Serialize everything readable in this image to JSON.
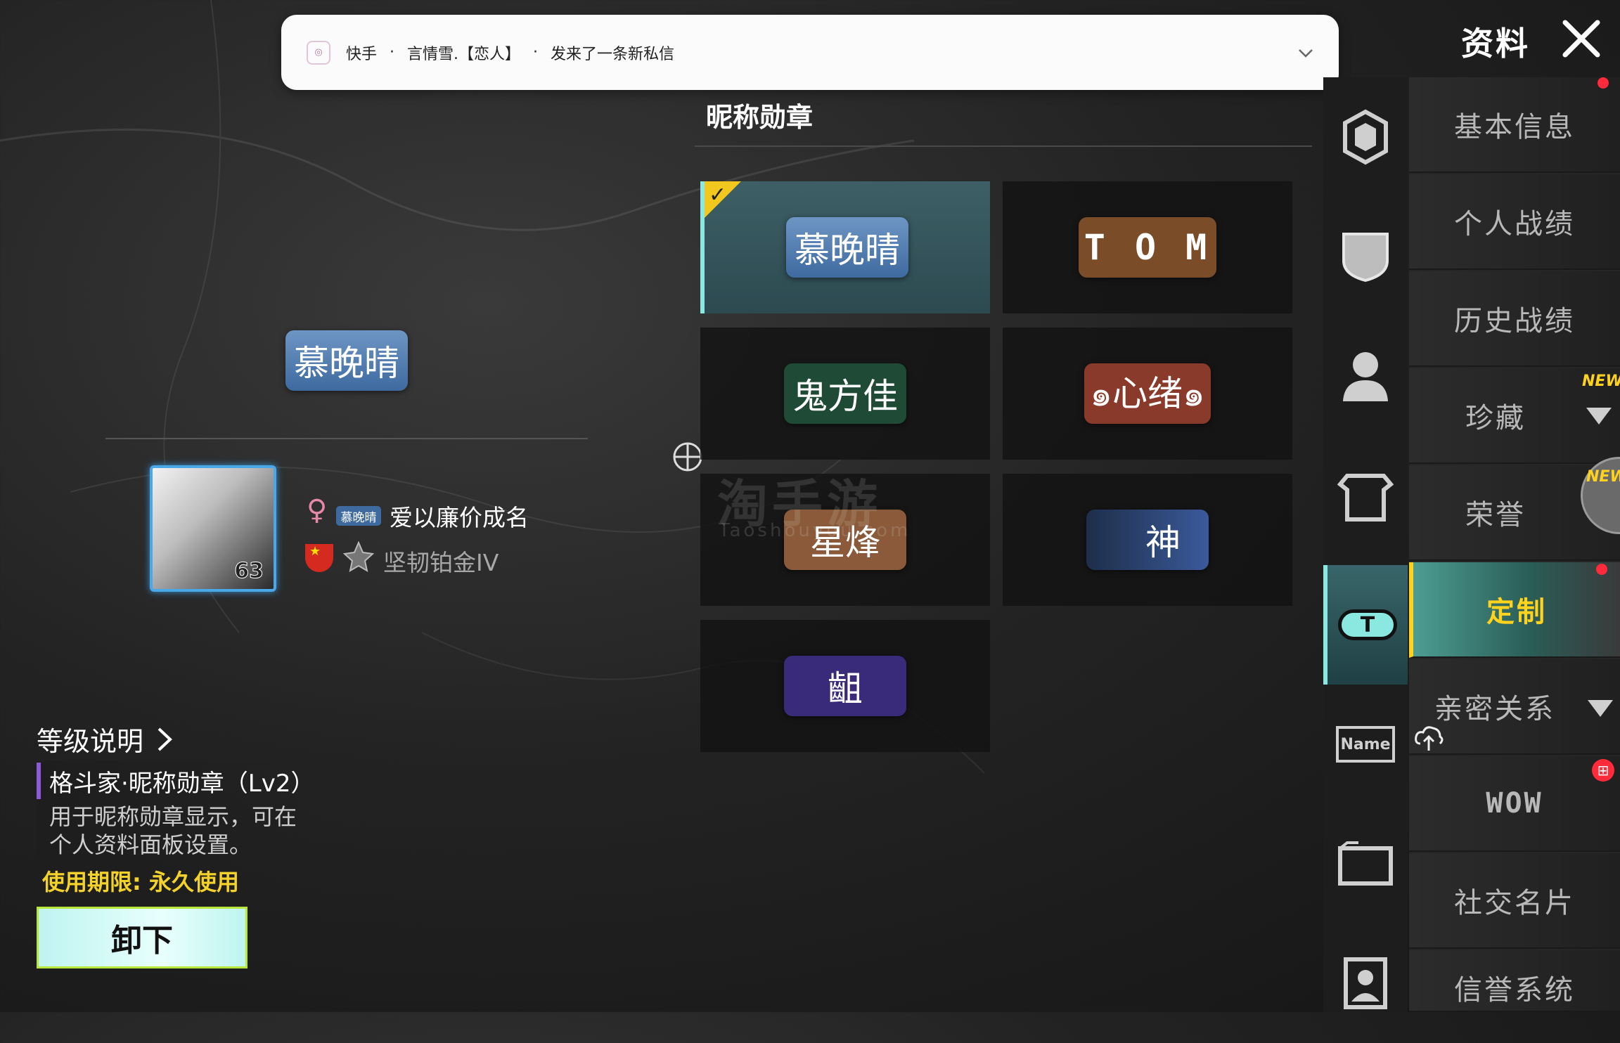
{
  "notification": {
    "app_name": "快手",
    "sender": "言情雪.【恋人】",
    "message": "发来了一条新私信",
    "separator": "·"
  },
  "header": {
    "title": "资料"
  },
  "left": {
    "preview_badge": "慕晚晴",
    "avatar_level": "63",
    "mini_badge": "慕晚晴",
    "player_name": "爱以廉价成名",
    "rank": "坚韧铂金IV",
    "level_link": "等级说明",
    "item_title": "格斗家·昵称勋章（Lv2）",
    "item_desc": "用于昵称勋章显示，可在个人资料面板设置。",
    "item_expire": "使用期限: 永久使用",
    "unequip_label": "卸下"
  },
  "center": {
    "title": "昵称勋章",
    "badges": [
      {
        "label": "慕晚晴",
        "color": "#4f7fb6",
        "selected": true
      },
      {
        "label": "T O M",
        "color": "#7a4c28"
      },
      {
        "label": "鬼方佳",
        "color": "#1f4a36"
      },
      {
        "label": "๑心绪๑",
        "color": "#8a3a2a"
      },
      {
        "label": "星烽",
        "color": "#8a5a3a"
      },
      {
        "label": "神",
        "color": "#2c4a7a"
      },
      {
        "label": "齟",
        "color": "#3a2a7a"
      }
    ],
    "watermark": "淘手游",
    "watermark_sub": "Taoshouyou.com"
  },
  "menu": {
    "items": [
      {
        "label": "基本信息"
      },
      {
        "label": "个人战绩"
      },
      {
        "label": "历史战绩"
      },
      {
        "label": "珍藏",
        "new": "NEW"
      },
      {
        "label": "荣誉",
        "new": "NEW"
      },
      {
        "label": "定制",
        "active": true
      },
      {
        "label": "亲密关系"
      },
      {
        "label": "WOW"
      },
      {
        "label": "社交名片"
      },
      {
        "label": "信誉系统"
      }
    ]
  },
  "icons": {
    "name_label": "Name",
    "t_label": "T"
  },
  "colors": {
    "accent_teal": "#8ae8e0",
    "accent_yellow": "#ffd21e",
    "badge_blue": "#4f7fb6"
  }
}
